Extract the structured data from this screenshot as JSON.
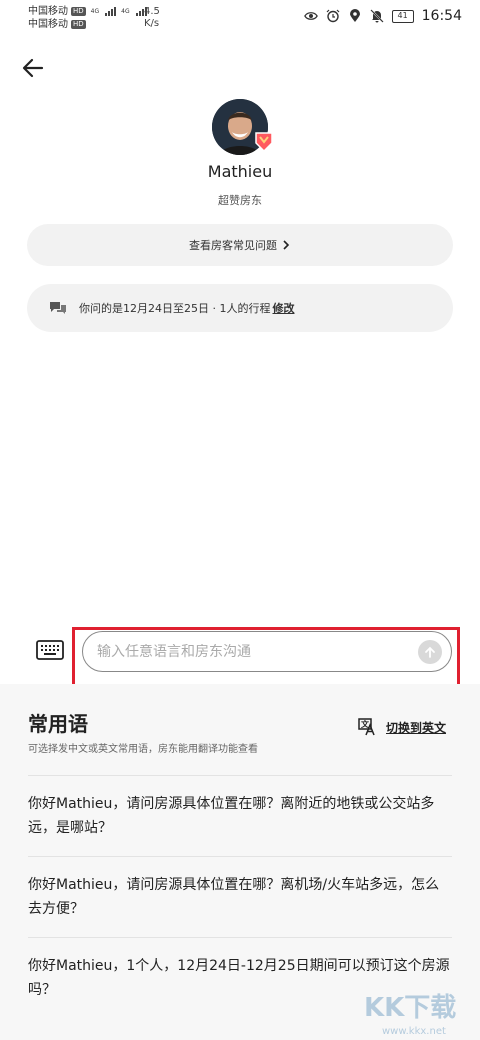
{
  "status_bar": {
    "carrier1": "中国移动",
    "carrier2": "中国移动",
    "hd": "HD",
    "net": "4G",
    "speed_value": "4.5",
    "speed_unit": "K/s",
    "battery": "41",
    "time": "16:54"
  },
  "host": {
    "name": "Mathieu",
    "subtitle": "超赞房东"
  },
  "faq": {
    "label": "查看房客常见问题"
  },
  "trip": {
    "text": "你问的是12月24日至25日 · 1人的行程",
    "edit_label": "修改"
  },
  "composer": {
    "placeholder": "输入任意语言和房东沟通",
    "value": ""
  },
  "phrases": {
    "title": "常用语",
    "subtitle": "可选择发中文或英文常用语，房东能用翻译功能查看",
    "switch_label": "切换到英文",
    "items": [
      "你好Mathieu，请问房源具体位置在哪？离附近的地铁或公交站多远，是哪站？",
      "你好Mathieu，请问房源具体位置在哪？离机场/火车站多远，怎么去方便？",
      "你好Mathieu，1个人，12月24日-12月25日期间可以预订这个房源吗？"
    ]
  },
  "watermark": {
    "text": "KK下载",
    "url": "www.kkx.net"
  },
  "colors": {
    "highlight": "#e02030",
    "pill_bg": "#f2f2f2",
    "panel_bg": "#f7f7f7",
    "badge": "#ff5a5f"
  },
  "icons": [
    "back-arrow-icon",
    "chevron-right-icon",
    "chat-bubbles-icon",
    "keyboard-icon",
    "send-arrow-icon",
    "translate-icon",
    "eye-icon",
    "alarm-icon",
    "location-icon",
    "mute-icon",
    "superhost-badge-icon"
  ]
}
